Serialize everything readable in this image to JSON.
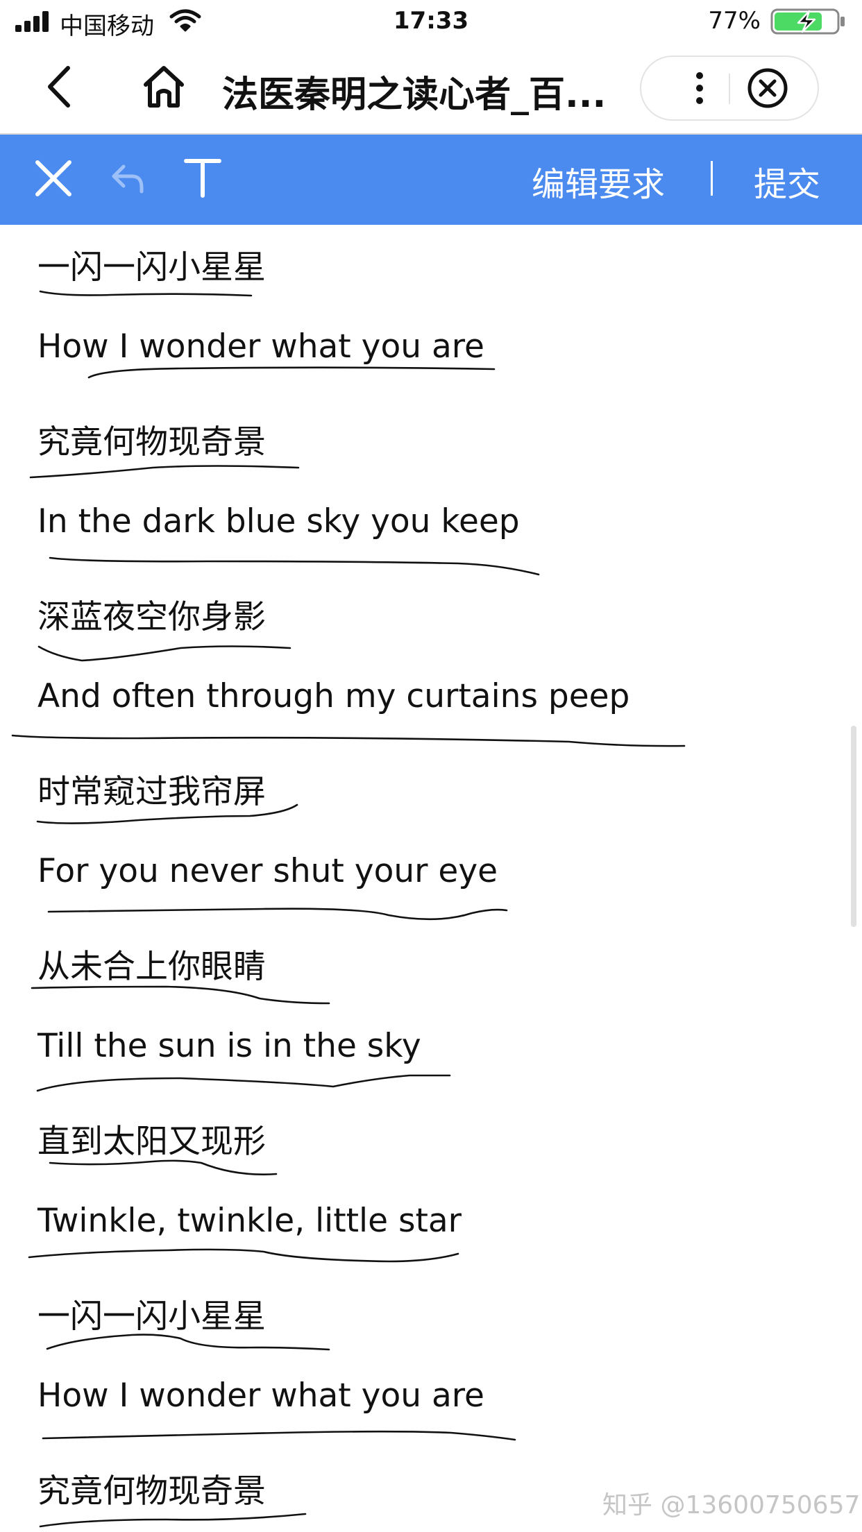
{
  "status_bar": {
    "carrier": "中国移动",
    "time": "17:33",
    "battery": "77%",
    "battery_level": 0.77,
    "charging": true
  },
  "title_bar": {
    "title": "法医秦明之读心者_百...",
    "back_icon": "chevron-left-icon",
    "home_icon": "home-icon",
    "more_icon": "more-vertical-icon",
    "close_icon": "circle-close-icon"
  },
  "edit_toolbar": {
    "close_icon": "close-icon",
    "undo_icon": "undo-icon",
    "text_icon": "text-tool-icon",
    "edit_requirements": "编辑要求",
    "separator": "|",
    "submit": "提交",
    "background_color": "#4b8bf0"
  },
  "lyrics": [
    "一闪一闪小星星",
    "How I wonder what you are",
    "究竟何物现奇景",
    "In the dark blue sky you keep",
    "深蓝夜空你身影",
    "And often through my curtains peep",
    "时常窥过我帘屏",
    "For you never shut your eye",
    "从未合上你眼睛",
    "Till the sun is in the sky",
    "直到太阳又现形",
    "Twinkle, twinkle, little star",
    "一闪一闪小星星",
    "How I wonder what you are",
    "究竟何物现奇景"
  ],
  "watermark": "知乎 @13600750657"
}
